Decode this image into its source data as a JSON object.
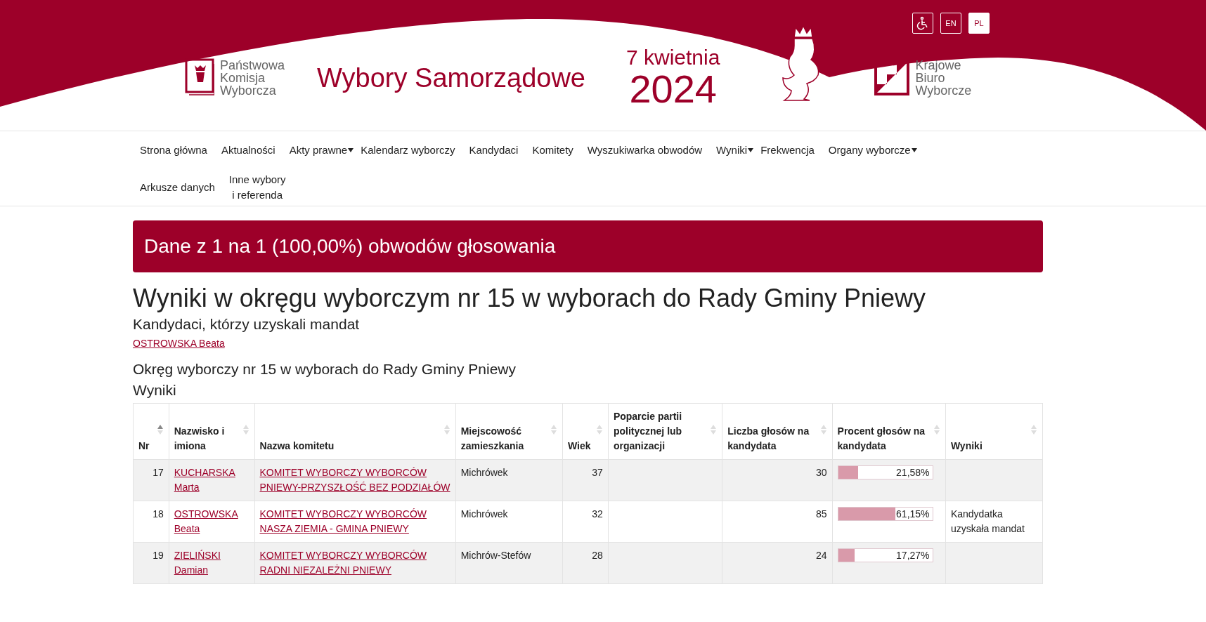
{
  "header": {
    "language_buttons": [
      {
        "label": "EN",
        "selected": false
      },
      {
        "label": "PL",
        "selected": true
      }
    ],
    "pkw_logo": [
      "Państwowa",
      "Komisja",
      "Wyborcza"
    ],
    "title": "Wybory Samorządowe",
    "date": "7 kwietnia",
    "year": "2024",
    "kbw_logo": [
      "Krajowe",
      "Biuro",
      "Wyborcze"
    ]
  },
  "nav": [
    {
      "label": "Strona główna",
      "dropdown": false
    },
    {
      "label": "Aktualności",
      "dropdown": false
    },
    {
      "label": "Akty prawne",
      "dropdown": true
    },
    {
      "label": "Kalendarz wyborczy",
      "dropdown": false
    },
    {
      "label": "Kandydaci",
      "dropdown": false
    },
    {
      "label": "Komitety",
      "dropdown": false
    },
    {
      "label": "Wyszukiwarka obwodów",
      "dropdown": false
    },
    {
      "label": "Wyniki",
      "dropdown": true
    },
    {
      "label": "Frekwencja",
      "dropdown": false
    },
    {
      "label": "Organy wyborcze",
      "dropdown": true
    },
    {
      "label": "Arkusze danych",
      "dropdown": false
    },
    {
      "label": "Inne wybory\ni referenda",
      "dropdown": false
    }
  ],
  "banner": "Dane z 1 na 1 (100,00%) obwodów głosowania",
  "heading": "Wyniki w okręgu wyborczym nr 15 w wyborach do Rady Gminy Pniewy",
  "elected_heading": "Kandydaci, którzy uzyskali mandat",
  "elected": [
    "OSTROWSKA Beata"
  ],
  "district_heading": "Okręg wyborczy nr 15 w wyborach do Rady Gminy Pniewy",
  "results_heading": "Wyniki",
  "table": {
    "columns": [
      {
        "label": "Nr",
        "sorted": true
      },
      {
        "label": "Nazwisko i imiona",
        "sorted": false
      },
      {
        "label": "Nazwa komitetu",
        "sorted": false
      },
      {
        "label": "Miejscowość zamieszkania",
        "sorted": false
      },
      {
        "label": "Wiek",
        "sorted": false
      },
      {
        "label": "Poparcie partii politycznej lub organizacji",
        "sorted": false
      },
      {
        "label": "Liczba głosów na kandydata",
        "sorted": false
      },
      {
        "label": "Procent głosów na kandydata",
        "sorted": false
      },
      {
        "label": "Wyniki",
        "sorted": false
      }
    ],
    "rows": [
      {
        "nr": "17",
        "name": "KUCHARSKA Marta",
        "committee": "KOMITET WYBORCZY WYBORCÓW PNIEWY-PRZYSZŁOŚĆ BEZ PODZIAŁÓW",
        "town": "Michrówek",
        "age": "37",
        "votes": "30",
        "level": 0.2158,
        "percent": "21,58%"
      },
      {
        "nr": "18",
        "name": "OSTROWSKA Beata",
        "committee": "KOMITET WYBORCZY WYBORCÓW NASZA ZIEMIA - GMINA PNIEWY",
        "town": "Michrówek",
        "age": "32",
        "votes": "85",
        "level": 0.6115,
        "percent": "61,15%",
        "result": "Kandydatka uzyskała mandat"
      },
      {
        "nr": "19",
        "name": "ZIELIŃSKI Damian",
        "committee": "KOMITET WYBORCZY WYBORCÓW RADNI NIEZALEŻNI PNIEWY",
        "town": "Michrów-Stefów",
        "age": "28",
        "votes": "24",
        "level": 0.1727,
        "percent": "17,27%"
      }
    ]
  }
}
